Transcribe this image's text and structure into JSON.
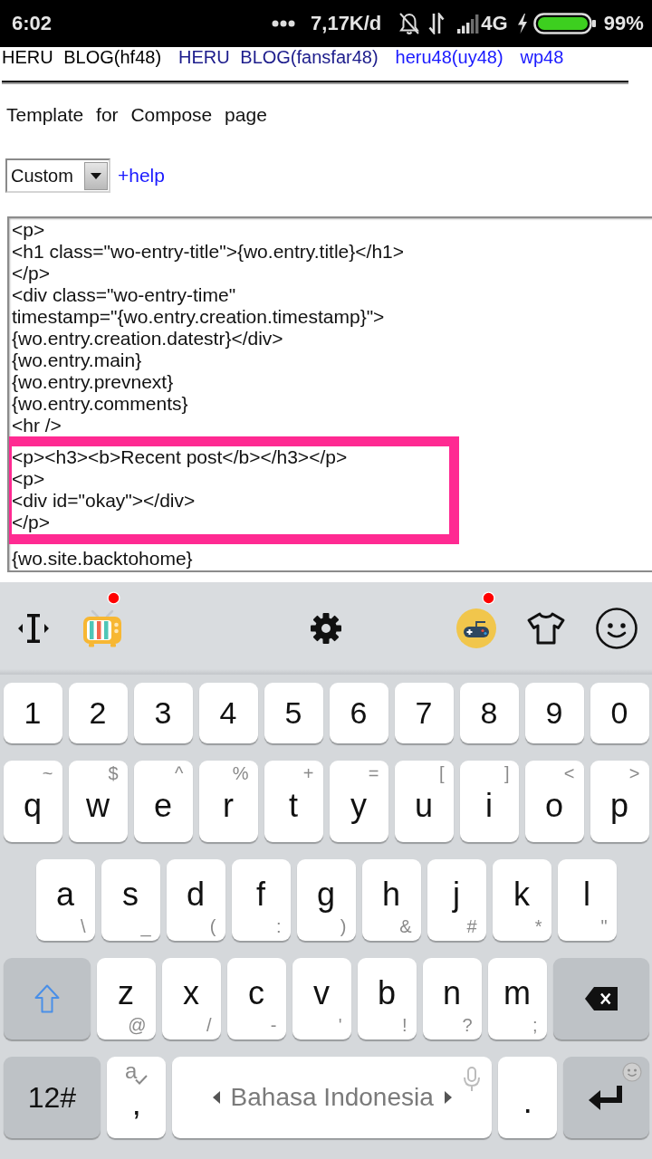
{
  "status_bar": {
    "time": "6:02",
    "network_speed": "7,17K/d",
    "network_type": "4G",
    "battery": "99%"
  },
  "links": [
    {
      "label": "HERU BLOG(hf48)",
      "color": "#000000"
    },
    {
      "label": "HERU BLOG(fansfar48)",
      "color": "#1c1c8c"
    },
    {
      "label": "heru48(uy48)",
      "color": "#1a1aff"
    },
    {
      "label": "wp48",
      "color": "#1a1aff"
    }
  ],
  "heading": "Template for Compose page",
  "template_select": {
    "value": "Custom"
  },
  "help_link": "+help",
  "editor": {
    "lines": [
      "<p>",
      "<h1 class=\"wo-entry-title\">{wo.entry.title}</h1>",
      "</p>",
      "<div class=\"wo-entry-time\"",
      "timestamp=\"{wo.entry.creation.timestamp}\">",
      "{wo.entry.creation.datestr}</div>",
      "{wo.entry.main}",
      "{wo.entry.prevnext}",
      "{wo.entry.comments}",
      "<hr />"
    ],
    "highlighted_lines": [
      "<p><h3><b>Recent post</b></h3></p>",
      "<p>",
      "<div id=\"okay\"></div>",
      "</p>"
    ],
    "lines_after": [
      "{wo.site.backtohome}"
    ]
  },
  "keyboard": {
    "toolbar": {
      "left": [
        {
          "kind": "cursor",
          "badge": false
        },
        {
          "kind": "tv",
          "badge": true
        }
      ],
      "center": [
        {
          "kind": "settings",
          "badge": false
        }
      ],
      "right": [
        {
          "kind": "game",
          "badge": true
        },
        {
          "kind": "theme",
          "badge": false
        },
        {
          "kind": "emoji",
          "badge": false
        }
      ]
    },
    "rows": [
      {
        "kind": "digits",
        "keys": [
          {
            "kind": "char",
            "label": "1"
          },
          {
            "kind": "char",
            "label": "2"
          },
          {
            "kind": "char",
            "label": "3"
          },
          {
            "kind": "char",
            "label": "4"
          },
          {
            "kind": "char",
            "label": "5"
          },
          {
            "kind": "char",
            "label": "6"
          },
          {
            "kind": "char",
            "label": "7"
          },
          {
            "kind": "char",
            "label": "8"
          },
          {
            "kind": "char",
            "label": "9"
          },
          {
            "kind": "char",
            "label": "0"
          }
        ]
      },
      {
        "kind": "raised",
        "keys": [
          {
            "kind": "char",
            "label": "q",
            "hint": "~"
          },
          {
            "kind": "char",
            "label": "w",
            "hint": "$"
          },
          {
            "kind": "char",
            "label": "e",
            "hint": "^"
          },
          {
            "kind": "char",
            "label": "r",
            "hint": "%"
          },
          {
            "kind": "char",
            "label": "t",
            "hint": "+"
          },
          {
            "kind": "char",
            "label": "y",
            "hint": "="
          },
          {
            "kind": "char",
            "label": "u",
            "hint": "["
          },
          {
            "kind": "char",
            "label": "i",
            "hint": "]"
          },
          {
            "kind": "char",
            "label": "o",
            "hint": "<"
          },
          {
            "kind": "char",
            "label": "p",
            "hint": ">"
          }
        ]
      },
      {
        "kind": "lowered",
        "keys": [
          {
            "kind": "char",
            "label": "a",
            "hint": "\\"
          },
          {
            "kind": "char",
            "label": "s",
            "hint": "_"
          },
          {
            "kind": "char",
            "label": "d",
            "hint": "("
          },
          {
            "kind": "char",
            "label": "f",
            "hint": ":"
          },
          {
            "kind": "char",
            "label": "g",
            "hint": ")"
          },
          {
            "kind": "char",
            "label": "h",
            "hint": "&"
          },
          {
            "kind": "char",
            "label": "j",
            "hint": "#"
          },
          {
            "kind": "char",
            "label": "k",
            "hint": "*"
          },
          {
            "kind": "char",
            "label": "l",
            "hint": "\""
          }
        ]
      },
      {
        "kind": "lowered",
        "keys": [
          {
            "kind": "shift"
          },
          {
            "kind": "char",
            "label": "z",
            "hint": "@"
          },
          {
            "kind": "char",
            "label": "x",
            "hint": "/"
          },
          {
            "kind": "char",
            "label": "c",
            "hint": "-"
          },
          {
            "kind": "char",
            "label": "v",
            "hint": "'"
          },
          {
            "kind": "char",
            "label": "b",
            "hint": "!"
          },
          {
            "kind": "char",
            "label": "n",
            "hint": "?"
          },
          {
            "kind": "char",
            "label": "m",
            "hint": ";"
          },
          {
            "kind": "backspace"
          }
        ]
      },
      {
        "kind": "base",
        "keys": [
          {
            "kind": "mode",
            "label": "12#"
          },
          {
            "kind": "comma",
            "label": ",",
            "hint": "a"
          },
          {
            "kind": "space",
            "label": "Bahasa Indonesia"
          },
          {
            "kind": "char",
            "label": "."
          },
          {
            "kind": "enter"
          }
        ]
      }
    ]
  }
}
